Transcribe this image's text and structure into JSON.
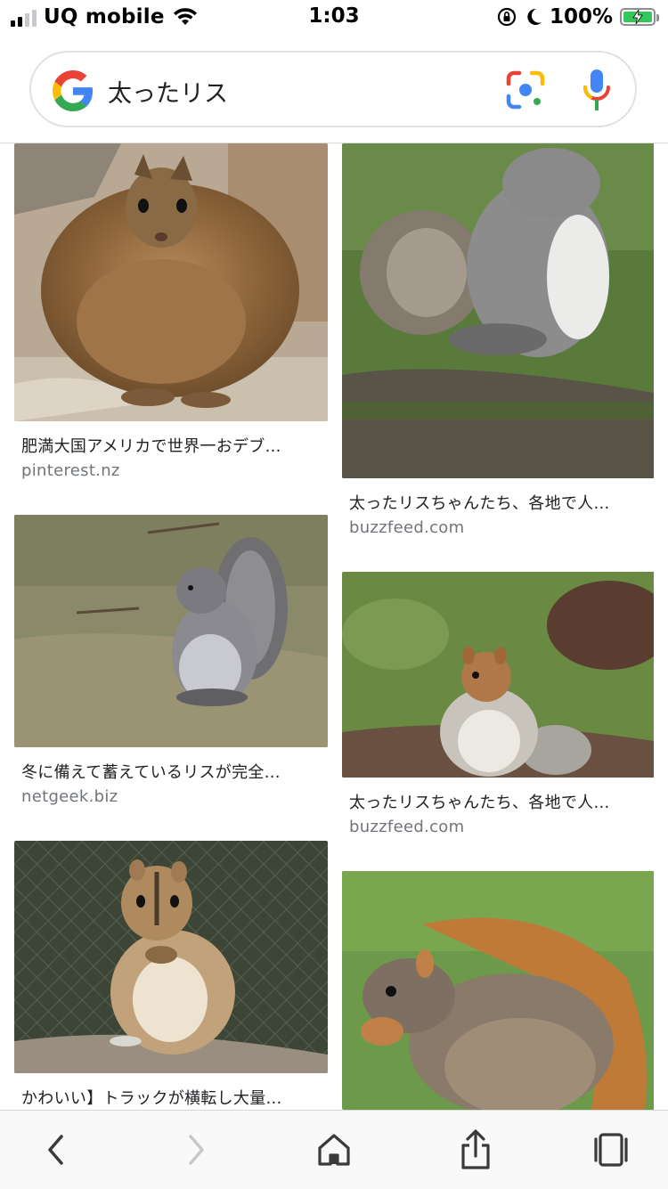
{
  "status_bar": {
    "carrier": "UQ mobile",
    "time": "1:03",
    "battery_percent": "100%",
    "battery_level": 1.0,
    "signal_bars": 2
  },
  "search": {
    "query": "太ったリス"
  },
  "results": [
    {
      "caption": "肥満大国アメリカで世界一おデブ...",
      "source": "pinterest.nz"
    },
    {
      "caption": "太ったリスちゃんたち、各地で人...",
      "source": "buzzfeed.com"
    },
    {
      "caption": "冬に備えて蓄えているリスが完全...",
      "source": "netgeek.biz"
    },
    {
      "caption": "太ったリスちゃんたち、各地で人...",
      "source": "buzzfeed.com"
    },
    {
      "caption": "かわいい】トラックが横転し大量...",
      "source": ""
    },
    {
      "caption": "",
      "source": ""
    }
  ],
  "toolbar": {
    "icons": [
      "back-icon",
      "forward-icon",
      "home-icon",
      "share-icon",
      "tabs-icon"
    ]
  },
  "colors": {
    "google_blue": "#4285F4",
    "google_red": "#EA4335",
    "google_yellow": "#FBBC05",
    "google_green": "#34A853",
    "battery_green": "#34c759"
  }
}
